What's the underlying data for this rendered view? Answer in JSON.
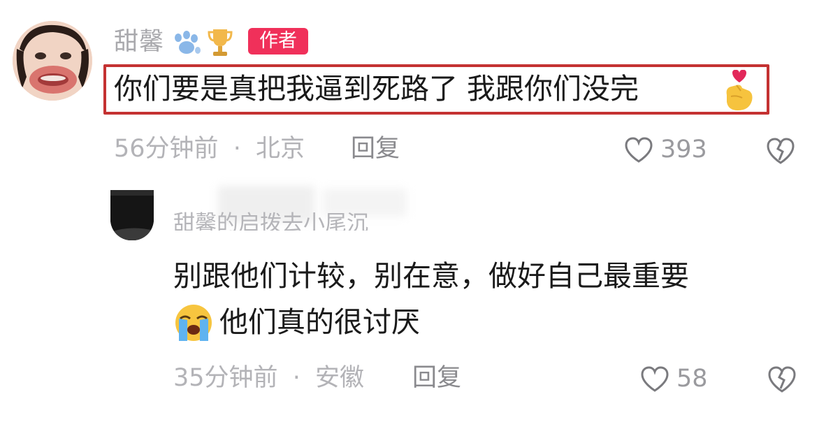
{
  "top_comment": {
    "avatar": "face-avatar",
    "username": "甜馨",
    "badges": [
      "paw-icon",
      "trophy-icon"
    ],
    "author_tag": "作者",
    "text": "你们要是真把我逼到死路了 我跟你们没完",
    "emoji": "finger-heart-icon",
    "time": "56分钟前",
    "separator": "·",
    "location": "北京",
    "reply_label": "回复",
    "like_count": "393",
    "highlight_color": "#c43232",
    "author_tag_color": "#f0305a"
  },
  "reply_comment": {
    "avatar": "dark-avatar",
    "username": "甜馨的启拨去小尾沉",
    "text_line1": "别跟他们计较，别在意，做好自己最重要",
    "emoji": "crying-face-icon",
    "text_line2": "他们真的很讨厌",
    "time": "35分钟前",
    "separator": "·",
    "location": "安徽",
    "reply_label": "回复",
    "like_count": "58"
  }
}
